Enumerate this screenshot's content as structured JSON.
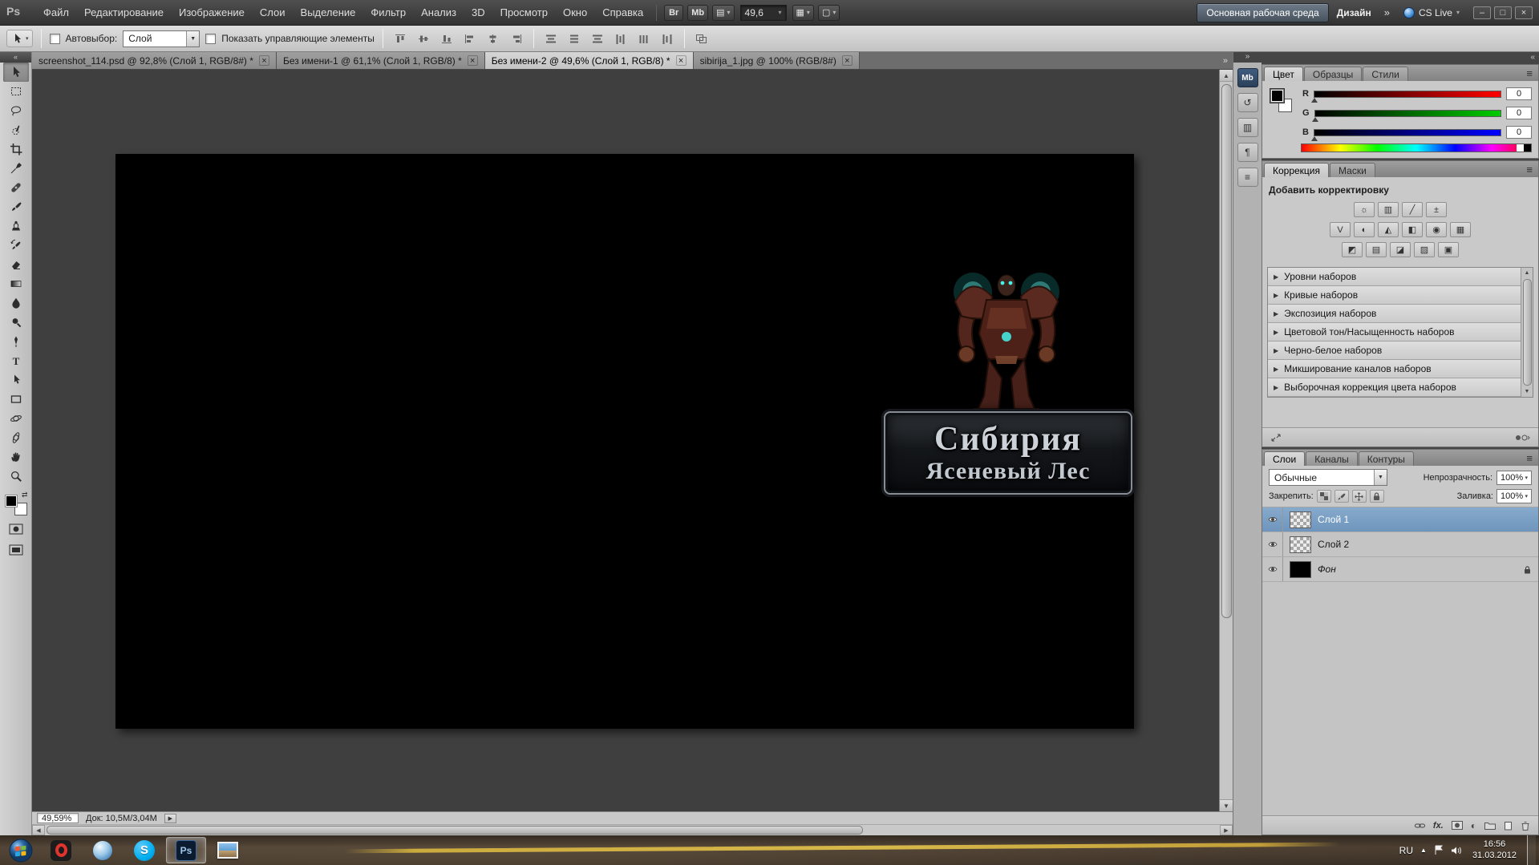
{
  "menu_bar": {
    "logo": "Ps",
    "items": [
      "Файл",
      "Редактирование",
      "Изображение",
      "Слои",
      "Выделение",
      "Фильтр",
      "Анализ",
      "3D",
      "Просмотр",
      "Окно",
      "Справка"
    ],
    "bridge_label": "Br",
    "mini_bridge_label": "Mb",
    "zoom_value": "49,6",
    "workspace_primary": "Основная рабочая среда",
    "workspace_secondary": "Дизайн",
    "cs_live_label": "CS Live"
  },
  "options_bar": {
    "autoselect_label": "Автовыбор:",
    "autoselect_value": "Слой",
    "show_controls_label": "Показать управляющие элементы"
  },
  "document_tabs": [
    {
      "title": "screenshot_114.psd @ 92,8% (Слой 1, RGB/8#) *"
    },
    {
      "title": "Без имени-1 @ 61,1% (Слой 1, RGB/8) *"
    },
    {
      "title": "Без имени-2 @ 49,6% (Слой 1, RGB/8) *"
    },
    {
      "title": "sibirija_1.jpg @ 100% (RGB/8#)"
    }
  ],
  "canvas": {
    "logo_line1": "Сибирия",
    "logo_line2": "Ясеневый Лес"
  },
  "status_bar": {
    "zoom": "49,59%",
    "doc_info": "Док: 10,5M/3,04M"
  },
  "icon_strip": {
    "mini_bridge": "Mb",
    "glyphs": [
      "↺",
      "▥",
      "¶",
      "≡"
    ]
  },
  "color_panel": {
    "tabs": [
      "Цвет",
      "Образцы",
      "Стили"
    ],
    "channels": [
      {
        "label": "R",
        "value": "0"
      },
      {
        "label": "G",
        "value": "0"
      },
      {
        "label": "B",
        "value": "0"
      }
    ]
  },
  "adjustments_panel": {
    "tabs": [
      "Коррекция",
      "Маски"
    ],
    "add_label": "Добавить корректировку",
    "icon_glyphs": [
      [
        "☼",
        "▥",
        "╱",
        "±"
      ],
      [
        "V",
        "◐",
        "◭",
        "◧",
        "◉",
        "▦"
      ],
      [
        "◩",
        "▤",
        "◪",
        "▨",
        "▣"
      ]
    ],
    "presets": [
      "Уровни наборов",
      "Кривые наборов",
      "Экспозиция наборов",
      "Цветовой тон/Насыщенность наборов",
      "Черно-белое наборов",
      "Микширование каналов наборов",
      "Выборочная коррекция цвета наборов"
    ]
  },
  "layers_panel": {
    "tabs": [
      "Слои",
      "Каналы",
      "Контуры"
    ],
    "blend_mode": "Обычные",
    "opacity_label": "Непрозрачность:",
    "opacity_value": "100%",
    "lock_label": "Закрепить:",
    "fill_label": "Заливка:",
    "fill_value": "100%",
    "layers": [
      {
        "name": "Слой 1"
      },
      {
        "name": "Слой 2"
      },
      {
        "name": "Фон"
      }
    ]
  },
  "taskbar": {
    "language": "RU",
    "time": "16:56",
    "date": "31.03.2012"
  },
  "icons": {
    "dropdown": "▾",
    "select_arrow": "▼",
    "panel_menu": "≡",
    "tab_close": "×",
    "collapse": "«",
    "expand": "»",
    "scroll_up": "▲",
    "scroll_down": "▼",
    "scroll_left": "◀",
    "scroll_right": "▶",
    "flyout": "▶",
    "preset_arrow": "▶",
    "minimize": "–",
    "restore": "□",
    "close": "×",
    "hidden_icons": "▲",
    "swap_colors": "⇄",
    "adjust_half": "◐"
  },
  "colors": {
    "selection_blue": "#7ba3cc",
    "menu_bar": "#3e3e3e",
    "canvas_area": "#3f3f3f",
    "panel_gray": "#c9c9c9",
    "doc_background": "#000000",
    "logo_text": "#ccd2d8",
    "glow_cyan": "#45e8de",
    "armor_red": "#5a2a20",
    "taskbar_brown": "#6b5a48",
    "road_yellow": "#d9b63e"
  }
}
